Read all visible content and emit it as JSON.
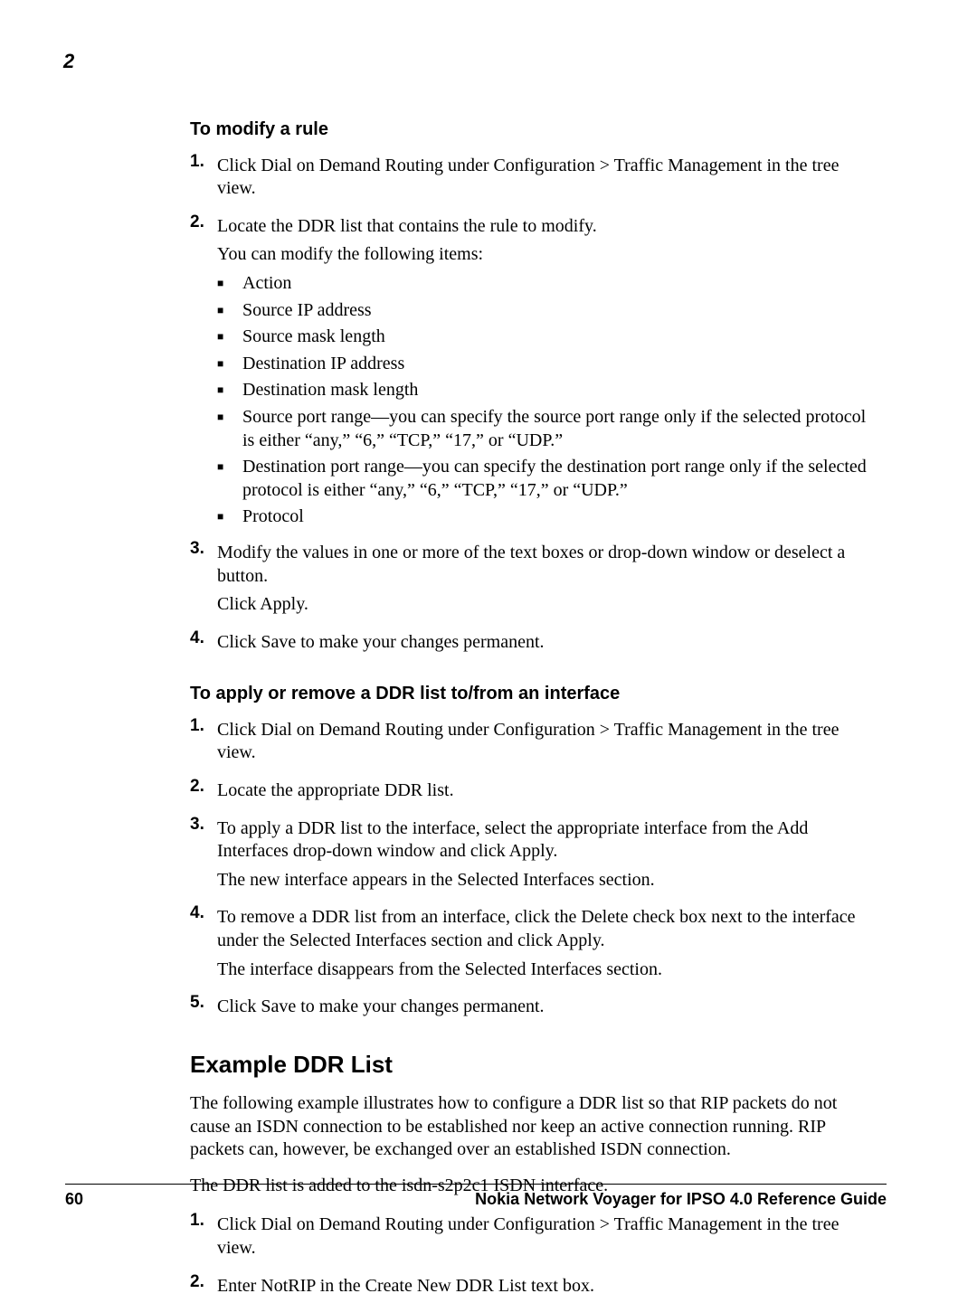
{
  "chapter_number": "2",
  "section1": {
    "heading": "To modify a rule",
    "steps": [
      {
        "num": "1.",
        "paras": [
          "Click Dial on Demand Routing under Configuration > Traffic Management in the tree view."
        ]
      },
      {
        "num": "2.",
        "paras": [
          "Locate the DDR list that contains the rule to modify.",
          "You can modify the following items:"
        ],
        "bullets": [
          "Action",
          "Source IP address",
          "Source mask length",
          "Destination IP address",
          "Destination mask length",
          "Source port range—you can specify the source port range only if the selected protocol is either “any,” “6,” “TCP,” “17,” or “UDP.”",
          "Destination port range—you can specify the destination port range only if the selected protocol is either “any,” “6,” “TCP,” “17,” or “UDP.”",
          "Protocol"
        ]
      },
      {
        "num": "3.",
        "paras": [
          "Modify the values in one or more of the text boxes or drop-down window or deselect a button.",
          "Click Apply."
        ]
      },
      {
        "num": "4.",
        "paras": [
          "Click Save to make your changes permanent."
        ]
      }
    ]
  },
  "section2": {
    "heading": "To apply or remove a DDR list to/from an interface",
    "steps": [
      {
        "num": "1.",
        "paras": [
          "Click Dial on Demand Routing under Configuration > Traffic Management in the tree view."
        ]
      },
      {
        "num": "2.",
        "paras": [
          "Locate the appropriate DDR list."
        ]
      },
      {
        "num": "3.",
        "paras": [
          "To apply a DDR list to the interface, select the appropriate interface from the Add Interfaces drop-down window and click Apply.",
          "The new interface appears in the Selected Interfaces section."
        ]
      },
      {
        "num": "4.",
        "paras": [
          "To remove a DDR list from an interface, click the Delete check box next to the interface under the Selected Interfaces section and click Apply.",
          "The interface disappears from the Selected Interfaces section."
        ]
      },
      {
        "num": "5.",
        "paras": [
          "Click Save to make your changes permanent."
        ]
      }
    ]
  },
  "section3": {
    "heading": "Example DDR List",
    "intro_paras": [
      "The following example illustrates how to configure a DDR list so that RIP packets do not cause an ISDN connection to be established nor keep an active connection running. RIP packets can, however, be exchanged over an established ISDN connection.",
      "The DDR list is added to the isdn-s2p2c1 ISDN interface."
    ],
    "steps": [
      {
        "num": "1.",
        "paras": [
          "Click Dial on Demand Routing under Configuration > Traffic Management in the tree view."
        ]
      },
      {
        "num": "2.",
        "paras": [
          "Enter NotRIP in the Create New DDR List text box."
        ]
      }
    ]
  },
  "footer": {
    "page_number": "60",
    "doc_title": "Nokia Network Voyager for IPSO 4.0 Reference Guide"
  }
}
